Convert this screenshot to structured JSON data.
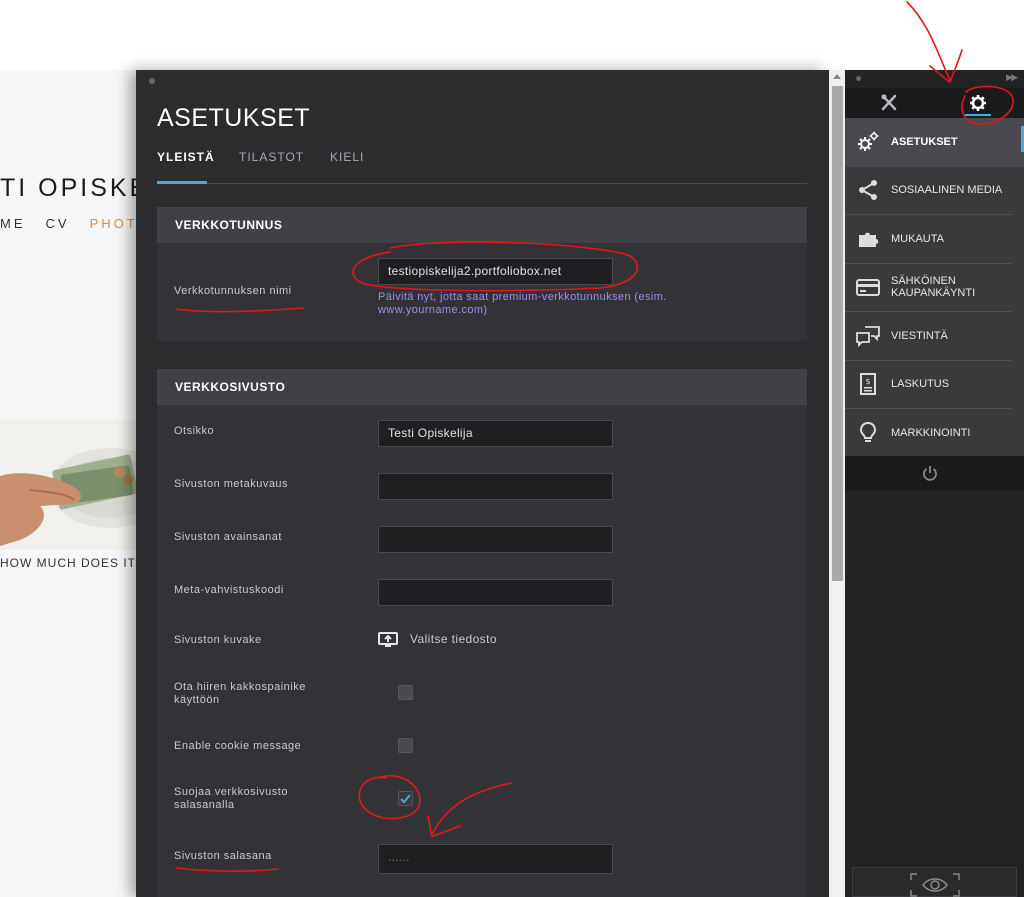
{
  "site": {
    "title": "TI OPISKE",
    "nav": [
      "ME",
      "CV",
      "PHOTO"
    ],
    "caption": "HOW MUCH DOES IT"
  },
  "modal": {
    "title": "ASETUKSET",
    "tabs": [
      {
        "label": "YLEISTÄ",
        "active": true
      },
      {
        "label": "TILASTOT",
        "active": false
      },
      {
        "label": "KIELI",
        "active": false
      }
    ],
    "domain_section": {
      "heading": "VERKKOTUNNUS",
      "domain_label": "Verkkotunnuksen nimi",
      "domain_value": "testiopiskelija2.portfoliobox.net",
      "upgrade_hint": "Päivitä nyt, jotta saat premium-verkkotunnuksen (esim. www.yourname.com)"
    },
    "website_section": {
      "heading": "VERKKOSIVUSTO",
      "title_label": "Otsikko",
      "title_value": "Testi Opiskelija",
      "meta_description_label": "Sivuston metakuvaus",
      "meta_description_value": "",
      "keywords_label": "Sivuston avainsanat",
      "keywords_value": "",
      "verification_label": "Meta-vahvistuskoodi",
      "verification_value": "",
      "favicon_label": "Sivuston kuvake",
      "favicon_button": "Valitse tiedosto",
      "right_click_label": "Ota hiiren kakkospainike käyttöön",
      "right_click_checked": false,
      "cookie_label": "Enable cookie message",
      "cookie_checked": false,
      "password_protect_label": "Suojaa verkkosivusto salasanalla",
      "password_protect_checked": true,
      "password_label": "Sivuston salasana",
      "password_value": "......"
    }
  },
  "panel": {
    "tabs": [
      {
        "icon": "tools-icon",
        "active": false
      },
      {
        "icon": "gear-icon",
        "active": true
      }
    ],
    "menu": [
      {
        "label": "ASETUKSET",
        "icon": "gears-icon",
        "active": true
      },
      {
        "label": "SOSIAALINEN MEDIA",
        "icon": "share-icon",
        "active": false
      },
      {
        "label": "MUKAUTA",
        "icon": "puzzle-icon",
        "active": false
      },
      {
        "label": "SÄHKÖINEN KAUPANKÄYNTI",
        "icon": "credit-card-icon",
        "active": false
      },
      {
        "label": "VIESTINTÄ",
        "icon": "chat-icon",
        "active": false
      },
      {
        "label": "LASKUTUS",
        "icon": "invoice-icon",
        "active": false
      },
      {
        "label": "MARKKINOINTI",
        "icon": "lightbulb-icon",
        "active": false
      }
    ]
  },
  "colors": {
    "accent": "#4aa8e0",
    "annotation": "#e01818",
    "hint": "#9a8ef0",
    "site_nav_active": "#e88a3c"
  }
}
